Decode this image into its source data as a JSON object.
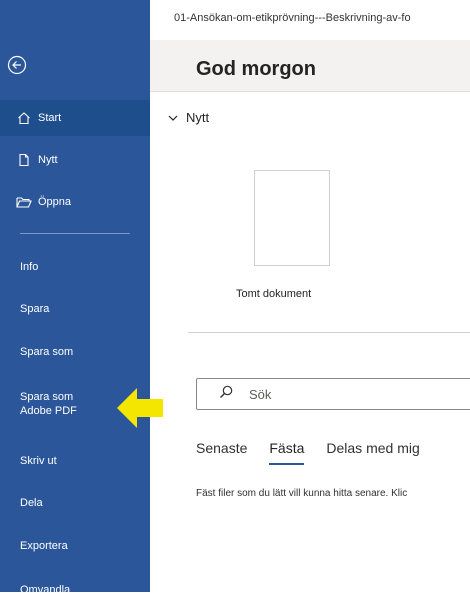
{
  "titlebar": {
    "filename": "01-Ansökan-om-etikprövning---Beskrivning-av-fo"
  },
  "main": {
    "greeting": "God morgon",
    "new_section": {
      "title": "Nytt",
      "template_label": "Tomt dokument"
    },
    "search": {
      "placeholder": "Sök"
    },
    "tabs": [
      {
        "label": "Senaste"
      },
      {
        "label": "Fästa"
      },
      {
        "label": "Delas med mig"
      }
    ],
    "selected_tab": "Fästa",
    "hint": "Fäst filer som du lätt vill kunna hitta senare. Klic"
  },
  "sidebar": {
    "items": [
      {
        "label": "Start",
        "icon": "home-icon"
      },
      {
        "label": "Nytt",
        "icon": "new-document-icon"
      },
      {
        "label": "Öppna",
        "icon": "open-folder-icon"
      },
      {
        "label": "Info"
      },
      {
        "label": "Spara"
      },
      {
        "label": "Spara som"
      },
      {
        "label": "Spara som\nAdobe PDF"
      },
      {
        "label": "Skriv ut"
      },
      {
        "label": "Dela"
      },
      {
        "label": "Exportera"
      },
      {
        "label": "Omvandla"
      }
    ]
  },
  "colors": {
    "sidebar_bg": "#2b579a",
    "arrow": "#f5e600",
    "accent": "#2b579a"
  }
}
